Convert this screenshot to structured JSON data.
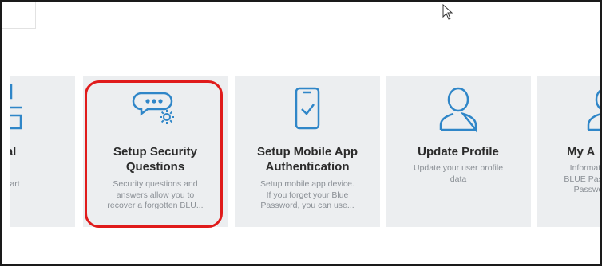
{
  "tiles": [
    {
      "title_lines": [
        "ational",
        "rt"
      ],
      "desc_lines": [
        "nal Chart"
      ],
      "icon": "org-chart-icon"
    },
    {
      "title_lines": [
        "Setup Security",
        "Questions"
      ],
      "desc_lines": [
        "Security questions and",
        "answers allow you to",
        "recover a forgotten BLU..."
      ],
      "icon": "chat-gear-icon"
    },
    {
      "title_lines": [
        "Setup Mobile App",
        "Authentication"
      ],
      "desc_lines": [
        "Setup mobile app device.",
        "If you forget your Blue",
        "Password, you can use..."
      ],
      "icon": "mobile-check-icon"
    },
    {
      "title_lines": [
        "Update Profile"
      ],
      "desc_lines": [
        "Update your user profile",
        "data"
      ],
      "icon": "user-profile-icon"
    },
    {
      "title_lines": [
        "My A"
      ],
      "desc_lines": [
        "Informatio",
        "BLUE Passw",
        "Passwo"
      ],
      "icon": "user-profile-icon"
    }
  ],
  "colors": {
    "highlight": "#e01b1b",
    "tile_bg": "#eceef0",
    "icon_blue": "#2f86c8"
  }
}
